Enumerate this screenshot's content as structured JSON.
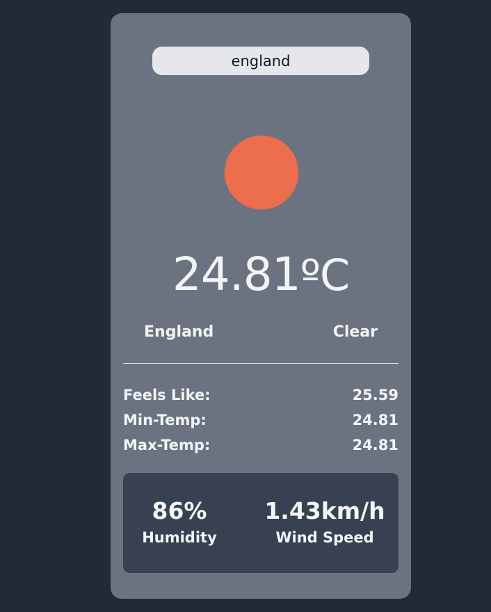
{
  "search": {
    "value": "england"
  },
  "weather": {
    "icon": "sun-icon",
    "icon_color": "#ec6e4c",
    "temperature": "24.81",
    "unit": "ºC",
    "location": "England",
    "condition": "Clear"
  },
  "details": [
    {
      "label": "Feels Like:",
      "value": "25.59"
    },
    {
      "label": "Min-Temp:",
      "value": "24.81"
    },
    {
      "label": "Max-Temp:",
      "value": "24.81"
    }
  ],
  "metrics": {
    "humidity": {
      "value": "86%",
      "label": "Humidity"
    },
    "wind": {
      "value": "1.43km/h",
      "label": "Wind Speed"
    }
  },
  "colors": {
    "background": "#222a38",
    "card": "#6b7280",
    "panel": "#374151",
    "text": "#f3f4f6"
  }
}
